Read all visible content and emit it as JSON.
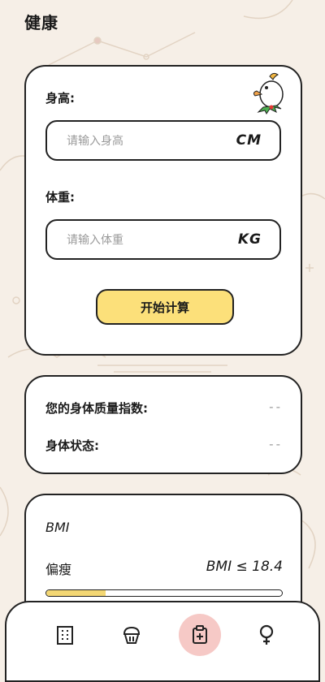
{
  "header": {
    "title": "健康"
  },
  "form": {
    "height_label": "身高:",
    "height_placeholder": "请输入身高",
    "height_value": "",
    "height_unit": "CM",
    "weight_label": "体重:",
    "weight_placeholder": "请输入体重",
    "weight_value": "",
    "weight_unit": "KG",
    "calc_button": "开始计算"
  },
  "result": {
    "bmi_label": "您的身体质量指数:",
    "bmi_value": "--",
    "status_label": "身体状态:",
    "status_value": "--"
  },
  "bmi_card": {
    "title": "BMI",
    "category": "偏瘦",
    "range": "BMI ≤ 18.4",
    "bar_fill_fraction": 0.25
  },
  "nav": {
    "items": [
      {
        "icon": "building-icon",
        "active": false
      },
      {
        "icon": "cupcake-icon",
        "active": false
      },
      {
        "icon": "medical-clipboard-icon",
        "active": true
      },
      {
        "icon": "female-symbol-icon",
        "active": false
      }
    ]
  },
  "colors": {
    "background": "#f6efe7",
    "button": "#fce07a",
    "bar_fill": "#f3d774",
    "nav_active": "#f6c9c6",
    "border": "#222222"
  }
}
